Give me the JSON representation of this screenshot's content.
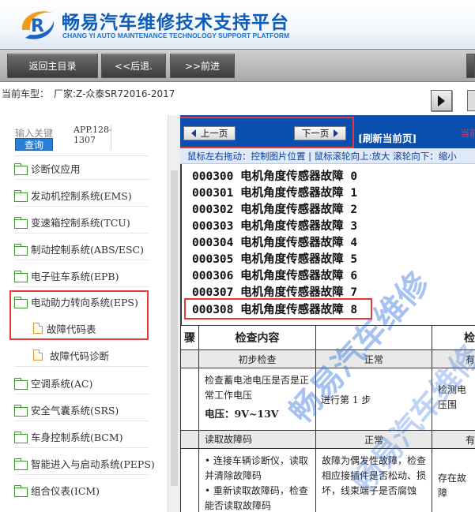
{
  "header": {
    "title": "畅易汽车维修技术支持平台",
    "subtitle": "CHANG YI AUTO MAINTENANCE TECHNOLOGY SUPPORT PLATFORM"
  },
  "toolbar": {
    "home_label": "返回主目录",
    "back_label": "<<后退.",
    "forward_label": ">>前进"
  },
  "infobar": {
    "model_label": "当前车型：",
    "model_value": "厂家:Z-众泰SR72016-2017"
  },
  "sidebar": {
    "search_label": "输入关键",
    "search_button": "查询",
    "app_id": "APP.128-1307",
    "items": [
      {
        "label": "诊断仪应用",
        "level": 1,
        "icon": "folder-icon"
      },
      {
        "label": "发动机控制系统(EMS)",
        "level": 1,
        "icon": "folder-icon"
      },
      {
        "label": "变速箱控制系统(TCU)",
        "level": 1,
        "icon": "folder-icon"
      },
      {
        "label": "制动控制系统(ABS/ESC)",
        "level": 1,
        "icon": "folder-icon"
      },
      {
        "label": "电子驻车系统(EPB)",
        "level": 1,
        "icon": "folder-icon"
      },
      {
        "label": "电动助力转向系统(EPS)",
        "level": 1,
        "icon": "folder-open-icon"
      },
      {
        "label": "故障代码表",
        "level": 2,
        "icon": "document-icon"
      },
      {
        "label": "故障代码诊断",
        "level": 2,
        "icon": "document-icon"
      },
      {
        "label": "空调系统(AC)",
        "level": 1,
        "icon": "folder-icon"
      },
      {
        "label": "安全气囊系统(SRS)",
        "level": 1,
        "icon": "folder-icon"
      },
      {
        "label": "车身控制系统(BCM)",
        "level": 1,
        "icon": "folder-icon"
      },
      {
        "label": "智能进入与启动系统(PEPS)",
        "level": 1,
        "icon": "folder-icon"
      },
      {
        "label": "组合仪表(ICM)",
        "level": 1,
        "icon": "folder-icon"
      }
    ]
  },
  "content": {
    "prev_label": "上一页",
    "next_label": "下一页",
    "refresh_label": "[刷新当前页]",
    "current_label": "当前",
    "hint": "鼠标左右拖动：控制图片位置 | 鼠标滚轮向上:放大  滚轮向下：缩小",
    "codes": [
      "000300 电机角度传感器故障 0",
      "000301 电机角度传感器故障 1",
      "000302 电机角度传感器故障 2",
      "000303 电机角度传感器故障 3",
      "000304 电机角度传感器故障 4",
      "000305 电机角度传感器故障 5",
      "000306 电机角度传感器故障 6",
      "000307 电机角度传感器故障 7",
      "000308 电机角度传感器故障 8"
    ],
    "table": {
      "col_step": "骤",
      "col_check": "检查内容",
      "col_result": "检",
      "row1_check": "初步检查",
      "row1_result": "正常",
      "row1_extra": "有",
      "row2_check_line1": "检查蓄电池电压是否是正常工作电压",
      "row2_check_line2": "电压：9V~13V",
      "row2_result": "进行第 1 步",
      "row2_extra": "检测电压围",
      "row3_check": "读取故障码",
      "row3_result": "正常",
      "row3_extra": "有",
      "row4_check": "• 连接车辆诊断仪，读取并清除故障码\n• 重新读取故障码，检查能否读取故障码",
      "row4_result": "故障为偶发性故障，检查相应接插件是否松动、损坏，线束端子是否腐蚀",
      "row4_extra": "存在故障"
    },
    "watermark": "畅易汽车维修"
  }
}
